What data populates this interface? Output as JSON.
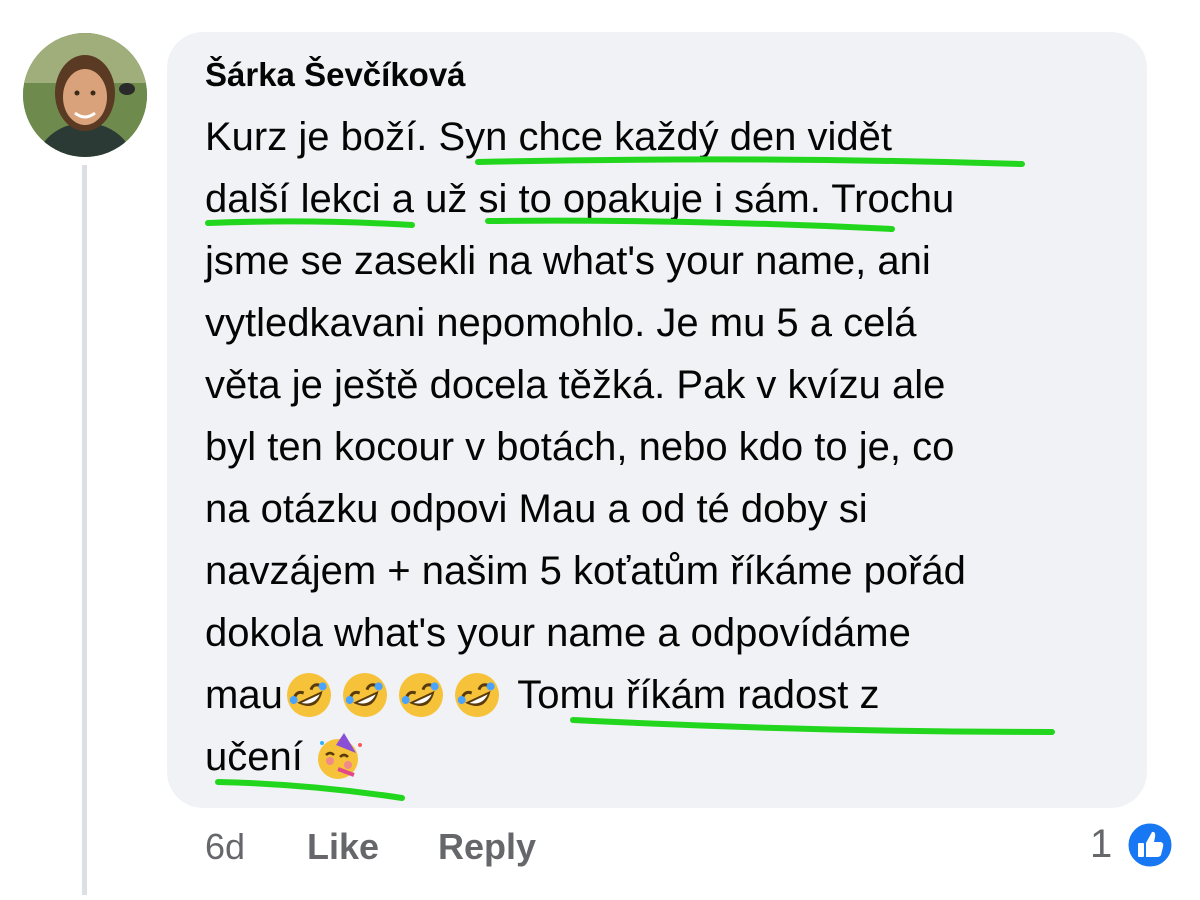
{
  "comment": {
    "author": "Šárka Ševčíková",
    "lines": [
      "Kurz je boží. Syn chce každý den vidět",
      "další lekci a už si to opakuje i sám. Trochu",
      "jsme se zasekli na what's your name, ani",
      "vytledkavani nepomohlo. Je mu 5 a celá",
      "věta je ještě docela těžká. Pak v kvízu ale",
      "byl ten kocour v botách, nebo kdo to je, co",
      "na otázku odpovi Mau a od té doby si",
      "navzájem + našim 5 koťatům říkáme pořád",
      "dokola what's your name a odpovídáme"
    ],
    "line10_start": "mau",
    "line10_end": " Tomu říkám radost z",
    "line11": "učení",
    "emojis": [
      "rolling-on-floor-laughing",
      "rolling-on-floor-laughing",
      "rolling-on-floor-laughing",
      "rolling-on-floor-laughing",
      "partying-face"
    ],
    "highlight_color": "#22d61e"
  },
  "footer": {
    "time": "6d",
    "like_label": "Like",
    "reply_label": "Reply",
    "reaction_count": "1",
    "reaction_icon": "thumbs-up-icon",
    "reaction_color": "#1877f2"
  }
}
